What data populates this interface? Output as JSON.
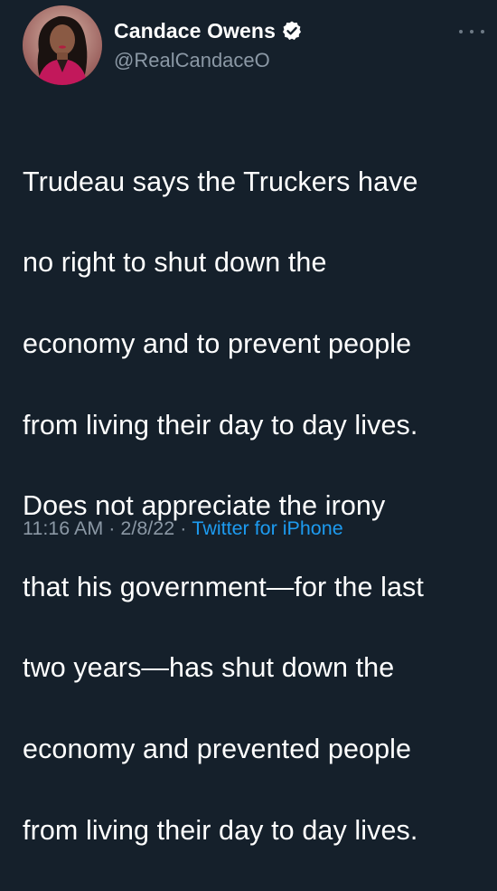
{
  "tweet": {
    "author": {
      "display_name": "Candace Owens",
      "handle": "@RealCandaceO",
      "verified": true,
      "avatar": "avatar-photo"
    },
    "body_lines": [
      "Trudeau says the Truckers have",
      "no right to shut down the",
      "economy and to prevent people",
      "from living their day to day lives.",
      "Does not appreciate the irony",
      "that his government—for the last",
      "two years—has shut down the",
      "economy and prevented people",
      "from living their day to day lives."
    ],
    "time": "11:16 AM",
    "separator": "·",
    "date": "2/8/22",
    "source": "Twitter for iPhone"
  },
  "icons": {
    "verified": "verified-badge-icon",
    "more": "more-options-icon"
  },
  "colors": {
    "background": "#15202b",
    "text": "#ffffff",
    "secondary": "#8b98a5",
    "link": "#1d9bf0"
  }
}
